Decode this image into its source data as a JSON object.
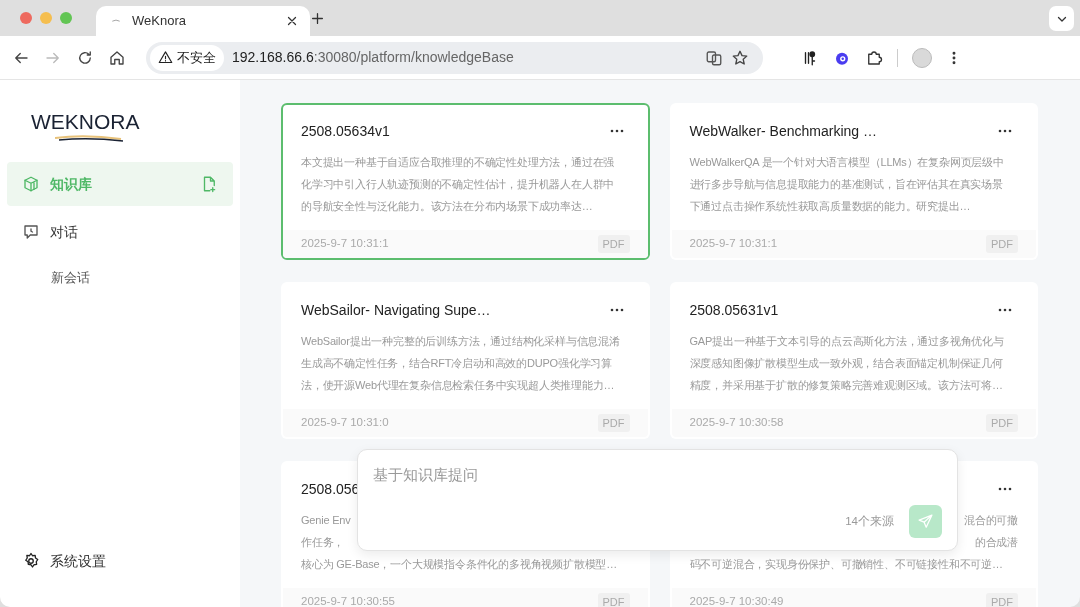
{
  "browser": {
    "tabs": [
      {
        "title": "WeKnora",
        "selected": true
      }
    ],
    "address": {
      "security": "不安全",
      "host": "192.168.66.6",
      "path": ":30080/platform/knowledgeBase"
    },
    "forward_disabled": true
  },
  "sidebar": {
    "logo": "WEKNORA",
    "items": [
      {
        "label": "知识库",
        "kind": "nav",
        "selected": true
      },
      {
        "label": "对话",
        "kind": "nav",
        "selected": false
      },
      {
        "label": "新会话",
        "kind": "sub",
        "selected": false
      }
    ],
    "settings": "系统设置"
  },
  "cards": [
    {
      "title": "2508.05634v1",
      "selected": true,
      "lines": [
        {
          "text": "本文提出一种基于自适应合取推理的不确定性处理方法，通过在强",
          "kind": "full"
        },
        {
          "text": "化学习中引入行人轨迹预测的不确定性估计，提升机器人在人群中",
          "kind": "full"
        },
        {
          "text": "的导航安全性与泛化能力。该方法在分布内场景下成功率达…",
          "kind": "full"
        }
      ],
      "time": "2025-9-7 10:31:1",
      "type": "PDF"
    },
    {
      "title": "WebWalker- Benchmarking …",
      "selected": false,
      "lines": [
        {
          "text": "WebWalkerQA 是一个针对大语言模型（LLMs）在复杂网页层级中",
          "kind": "full"
        },
        {
          "text": "进行多步导航与信息提取能力的基准测试，旨在评估其在真实场景",
          "kind": "full"
        },
        {
          "text": "下通过点击操作系统性获取高质量数据的能力。研究提出…",
          "kind": "full"
        }
      ],
      "time": "2025-9-7 10:31:1",
      "type": "PDF"
    },
    {
      "title": "WebSailor- Navigating Supe…",
      "selected": false,
      "lines": [
        {
          "text": "WebSailor提出一种完整的后训练方法，通过结构化采样与信息混淆",
          "kind": "full"
        },
        {
          "text": "生成高不确定性任务，结合RFT冷启动和高效的DUPO强化学习算",
          "kind": "full"
        },
        {
          "text": "法，使开源Web代理在复杂信息检索任务中实现超人类推理能力…",
          "kind": "full"
        }
      ],
      "time": "2025-9-7 10:31:0",
      "type": "PDF"
    },
    {
      "title": "2508.05631v1",
      "selected": false,
      "lines": [
        {
          "text": "GAP提出一种基于文本引导的点云高斯化方法，通过多视角优化与",
          "kind": "full"
        },
        {
          "text": "深度感知图像扩散模型生成一致外观，结合表面锚定机制保证几何",
          "kind": "full"
        },
        {
          "text": "精度，并采用基于扩散的修复策略完善难观测区域。该方法可将…",
          "kind": "full"
        }
      ],
      "time": "2025-9-7 10:30:58",
      "type": "PDF"
    },
    {
      "title": "2508.056",
      "selected": false,
      "lines": [
        {
          "text": "Genie Env",
          "kind": "head"
        },
        {
          "text": "作任务，",
          "kind": "head"
        },
        {
          "text": "核心为 GE-Base，一个大规模指令条件化的多视角视频扩散模型…",
          "kind": "full"
        }
      ],
      "time": "2025-9-7 10:30:55",
      "type": "PDF"
    },
    {
      "selected": false,
      "lines": [
        {
          "text": "混合的可撤",
          "kind": "tail"
        },
        {
          "text": "的合成潜",
          "kind": "tail"
        },
        {
          "text": "码不可逆混合，实现身份保护、可撤销性、不可链接性和不可逆…",
          "kind": "full"
        }
      ],
      "time": "2025-9-7 10:30:49",
      "type": "PDF"
    }
  ],
  "ask_box": {
    "placeholder": "基于知识库提问",
    "sources": "14个来源"
  }
}
